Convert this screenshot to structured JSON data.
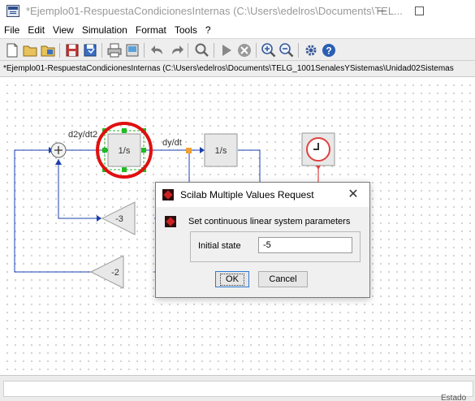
{
  "window": {
    "title": "*Ejemplo01-RespuestaCondicionesInternas (C:\\Users\\edelros\\Documents\\TEL...",
    "icon": "scilab-xcos-icon"
  },
  "menu": [
    "File",
    "Edit",
    "View",
    "Simulation",
    "Format",
    "Tools",
    "?"
  ],
  "toolbar": [
    "new-diagram-icon",
    "open-icon",
    "open-in-icon",
    "save-icon",
    "save-as-icon",
    "print-icon",
    "export-icon",
    "undo-icon",
    "redo-icon",
    "fit-zoom-icon",
    "start-icon",
    "stop-icon",
    "zoom-in-icon",
    "zoom-out-icon",
    "setup-icon",
    "help-icon"
  ],
  "path": "*Ejemplo01-RespuestaCondicionesInternas (C:\\Users\\edelros\\Documents\\TELG_1001SenalesYSistemas\\Unidad02Sistemas",
  "diagram": {
    "labels": {
      "d2": "d2y/dt2",
      "d1": "dy/dt"
    },
    "integrator1": "1/s",
    "integrator2": "1/s",
    "gain1": "-3",
    "gain2": "-2"
  },
  "status": "Estado",
  "dialog": {
    "title": "Scilab Multiple Values Request",
    "heading": "Set continuous linear system parameters",
    "field_label": "Initial state",
    "field_value": "-5",
    "ok": "OK",
    "cancel": "Cancel",
    "close": "✕"
  },
  "colors": {
    "annotation_circle": "#e01010",
    "block_selection": "#22bb22",
    "wire": "#1a3fb0",
    "clock_link": "#e04040"
  }
}
